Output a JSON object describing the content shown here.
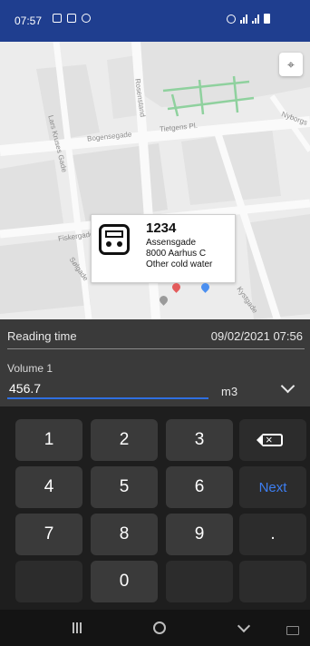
{
  "status_bar": {
    "time": "07:57"
  },
  "map": {
    "streets": [
      "Lars Kruses Gade",
      "Bogensegade",
      "Tietgens Pl.",
      "Nyborgs",
      "Fiskergade",
      "Sølgade",
      "Kystgade",
      "Rosenstand"
    ],
    "info_card": {
      "meter_id": "1234",
      "street": "Assensgade",
      "city": "8000 Aarhus C",
      "meter_type": "Other cold water"
    }
  },
  "reading": {
    "time_label": "Reading time",
    "time_value": "09/02/2021 07:56",
    "volume_label": "Volume 1",
    "volume_value": "456.7",
    "unit": "m3"
  },
  "keypad": {
    "keys": [
      "1",
      "2",
      "3",
      "4",
      "5",
      "6",
      "7",
      "8",
      "9",
      "0"
    ],
    "next_label": "Next",
    "dot_label": "."
  },
  "colors": {
    "status_bar": "#1f3e8f",
    "accent": "#2f6fe0",
    "next_key": "#3d7ef0"
  }
}
